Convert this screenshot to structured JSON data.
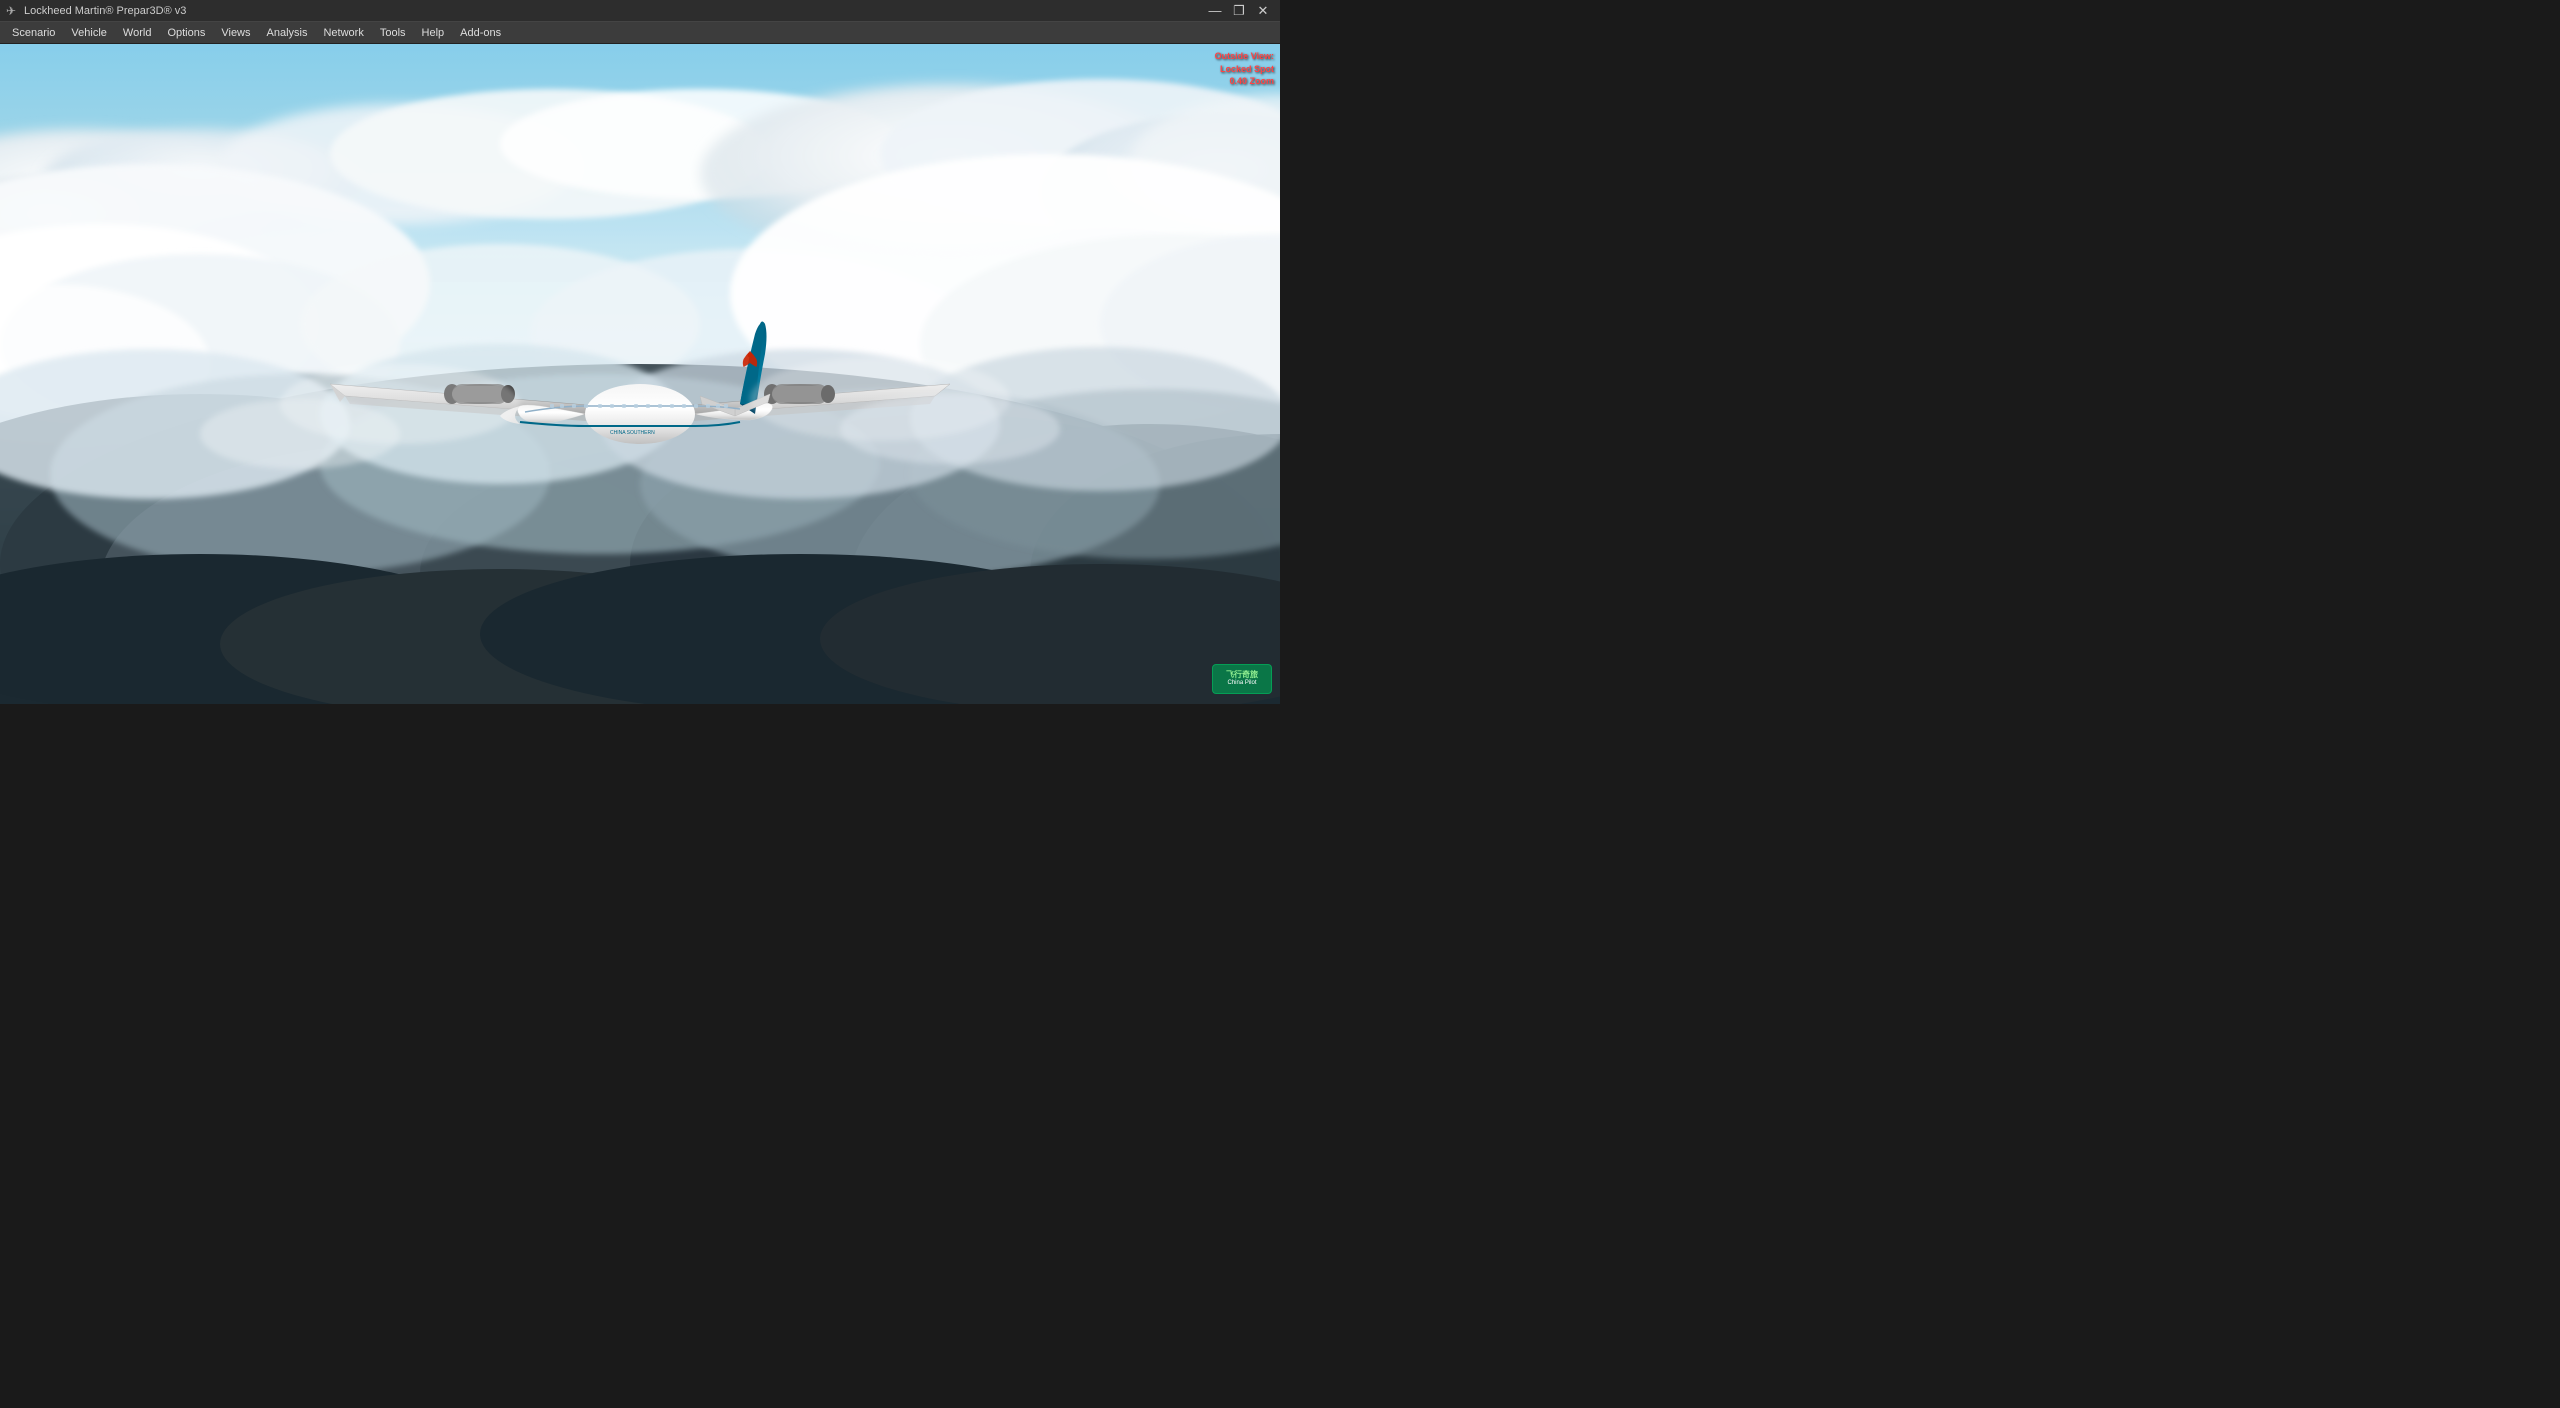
{
  "titlebar": {
    "title": "Lockheed Martin® Prepar3D® v3",
    "icon": "✈",
    "controls": {
      "minimize": "—",
      "restore": "❐",
      "close": "✕"
    }
  },
  "menubar": {
    "items": [
      {
        "label": "Scenario",
        "id": "scenario"
      },
      {
        "label": "Vehicle",
        "id": "vehicle"
      },
      {
        "label": "World",
        "id": "world"
      },
      {
        "label": "Options",
        "id": "options"
      },
      {
        "label": "Views",
        "id": "views"
      },
      {
        "label": "Analysis",
        "id": "analysis"
      },
      {
        "label": "Network",
        "id": "network"
      },
      {
        "label": "Tools",
        "id": "tools"
      },
      {
        "label": "Help",
        "id": "help"
      },
      {
        "label": "Add-ons",
        "id": "addons"
      }
    ]
  },
  "hud": {
    "line1": "Outside View:",
    "line2": "Locked Spot",
    "line3": "0.40 Zoom"
  },
  "watermark": {
    "line1": "飞行奇旅",
    "line2": "China Pilot"
  },
  "scene": {
    "description": "Boeing 777 China Southern Airlines flying above clouds"
  }
}
